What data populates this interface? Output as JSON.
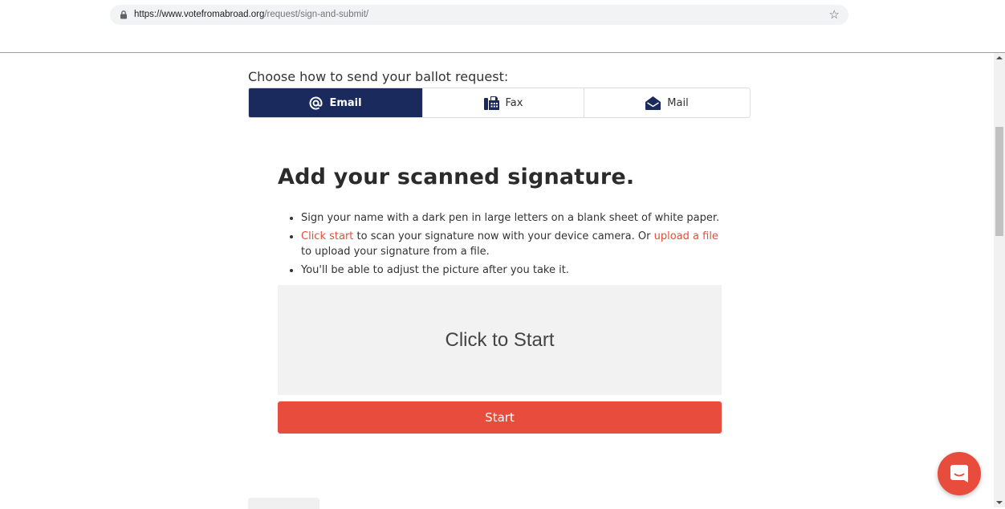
{
  "browser": {
    "url_host": "https://www.votefromabroad.org",
    "url_path": "/request/sign-and-submit/",
    "icons": {
      "lock": "lock-icon",
      "bookmark": "star-icon"
    }
  },
  "send_method": {
    "prompt": "Choose how to send your ballot request:",
    "tabs": [
      {
        "label": "Email",
        "icon": "at-icon",
        "selected": true
      },
      {
        "label": "Fax",
        "icon": "fax-icon",
        "selected": false
      },
      {
        "label": "Mail",
        "icon": "envelope-open-icon",
        "selected": false
      }
    ]
  },
  "signature": {
    "heading": "Add your scanned signature.",
    "bullets": {
      "b1": "Sign your name with a dark pen in large letters on a blank sheet of white paper.",
      "b2_link1": "Click start",
      "b2_mid": " to scan your signature now with your device camera. Or ",
      "b2_link2": "upload a file",
      "b2_end": " to upload your signature from a file.",
      "b3": "You'll be able to adjust the picture after you take it."
    },
    "drop_area_label": "Click to Start",
    "start_button": "Start"
  },
  "colors": {
    "primary_navy": "#1a2a5c",
    "accent_red": "#e74c3c",
    "drop_area_bg": "#f2f2f2"
  },
  "chat": {
    "icon": "chat-bubble-icon"
  }
}
